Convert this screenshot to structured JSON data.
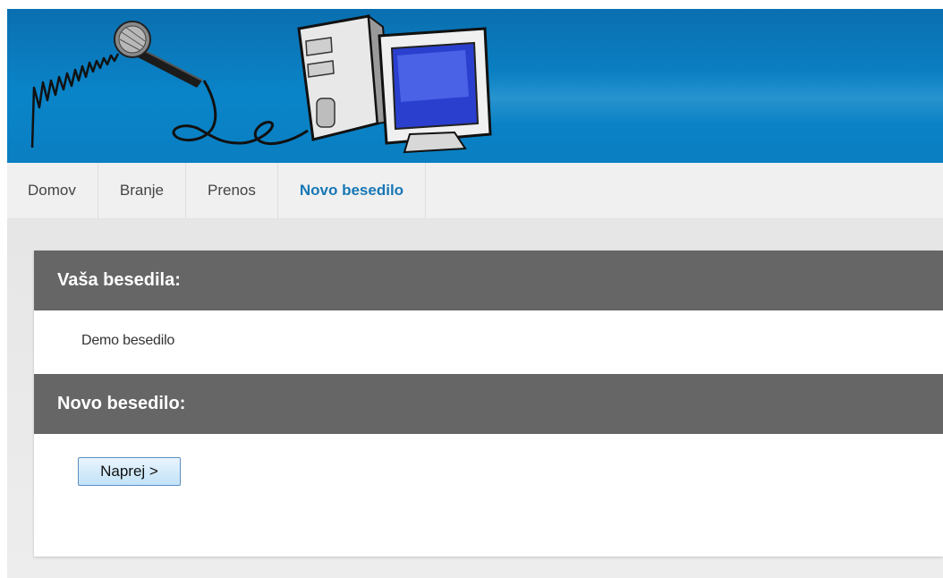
{
  "nav": {
    "items": [
      {
        "label": "Domov"
      },
      {
        "label": "Branje"
      },
      {
        "label": "Prenos"
      },
      {
        "label": "Novo besedilo"
      }
    ]
  },
  "sections": {
    "texts_heading": "Vaša besedila:",
    "texts": [
      "Demo besedilo"
    ],
    "new_heading": "Novo besedilo:",
    "next_button": "Naprej >"
  },
  "colors": {
    "header_blue": "#0a84c8",
    "active_nav": "#1877b5",
    "section_bar": "#666666"
  },
  "icons": {
    "logo": "microphone-computer-logo"
  }
}
